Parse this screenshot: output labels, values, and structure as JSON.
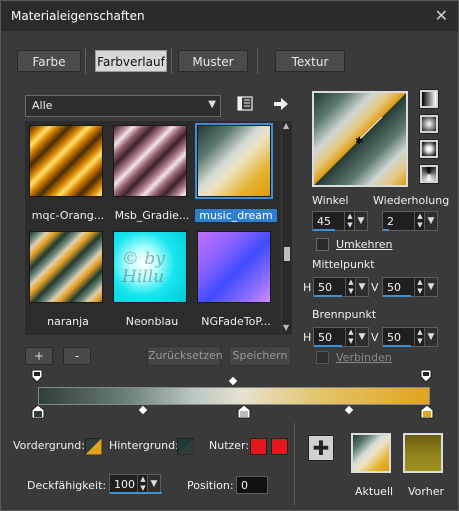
{
  "window": {
    "title": "Materialeigenschaften",
    "close_glyph": "✕"
  },
  "tabs": [
    {
      "label": "Farbe",
      "active": false
    },
    {
      "label": "Farbverlauf",
      "active": true
    },
    {
      "label": "Muster",
      "active": false
    },
    {
      "label": "Textur",
      "active": false
    }
  ],
  "category": {
    "selected": "Alle"
  },
  "gradients": [
    {
      "name": "mqc-Orang...",
      "selected": false
    },
    {
      "name": "Msb_Gradie...",
      "selected": false
    },
    {
      "name": "music_dream",
      "selected": true
    },
    {
      "name": "naranja",
      "selected": false
    },
    {
      "name": "Neonblau",
      "selected": false
    },
    {
      "name": "NGFadeToP...",
      "selected": false
    }
  ],
  "thumb_watermark": "© by Hillu",
  "angle": {
    "label": "Winkel",
    "value": "45"
  },
  "repeat": {
    "label": "Wiederholung",
    "value": "2"
  },
  "invert": {
    "label": "Umkehren",
    "checked": false
  },
  "center": {
    "label": "Mittelpunkt",
    "h_label": "H",
    "h_value": "50",
    "v_label": "V",
    "v_value": "50"
  },
  "focal": {
    "label": "Brennpunkt",
    "h_label": "H",
    "h_value": "50",
    "v_label": "V",
    "v_value": "50"
  },
  "link": {
    "label": "Verbinden",
    "checked": false
  },
  "buttons": {
    "add": "+",
    "remove": "-",
    "reset": "Zurücksetzen",
    "save": "Speichern"
  },
  "foreground": {
    "label": "Vordergrund:"
  },
  "background": {
    "label": "Hintergrund:"
  },
  "user": {
    "label": "Nutzer:",
    "color": "#e3171c"
  },
  "opacity": {
    "label": "Deckfähigkeit:",
    "value": "100"
  },
  "position": {
    "label": "Position:",
    "value": "0"
  },
  "current": {
    "label": "Aktuell"
  },
  "previous": {
    "label": "Vorher"
  },
  "colors": {
    "accent": "#2f7fd0",
    "gradient_start": "#2f3e38",
    "gradient_end": "#e2a41c"
  },
  "icons": [
    "close-icon",
    "gradient-editor-icon",
    "arrow-right-icon",
    "chevron-down-icon",
    "plus-icon"
  ]
}
